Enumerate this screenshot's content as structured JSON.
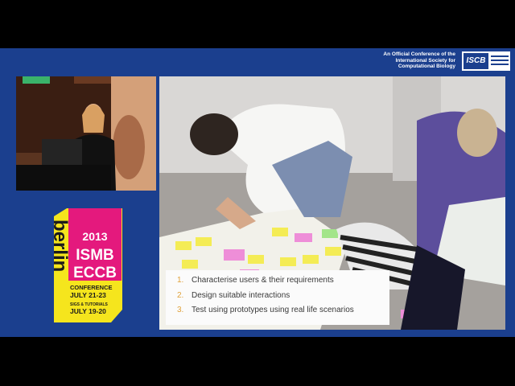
{
  "header": {
    "caption_lines": [
      "An Official Conference of the",
      "International Society for",
      "Computational Biology"
    ],
    "iscb_logo_text": "ISCB"
  },
  "slide": {
    "points": [
      {
        "num": "1.",
        "text": "Characterise users & their requirements"
      },
      {
        "num": "2.",
        "text": "Design suitable interactions"
      },
      {
        "num": "3.",
        "text": "Test using prototypes using real life scenarios"
      }
    ]
  },
  "conference_logo": {
    "year": "2013",
    "name_lines": [
      "ISMB",
      "ECCB"
    ],
    "city": "berlin",
    "conference_label": "CONFERENCE",
    "conference_dates": "JULY 21-23",
    "sigs_label": "SIGS & TUTORIALS",
    "sigs_dates": "JULY 19-20"
  },
  "colors": {
    "frame_blue": "#1b3f8e",
    "logo_yellow": "#f5e51d",
    "logo_magenta": "#e4197d",
    "bullet_number": "#e0a13a"
  }
}
